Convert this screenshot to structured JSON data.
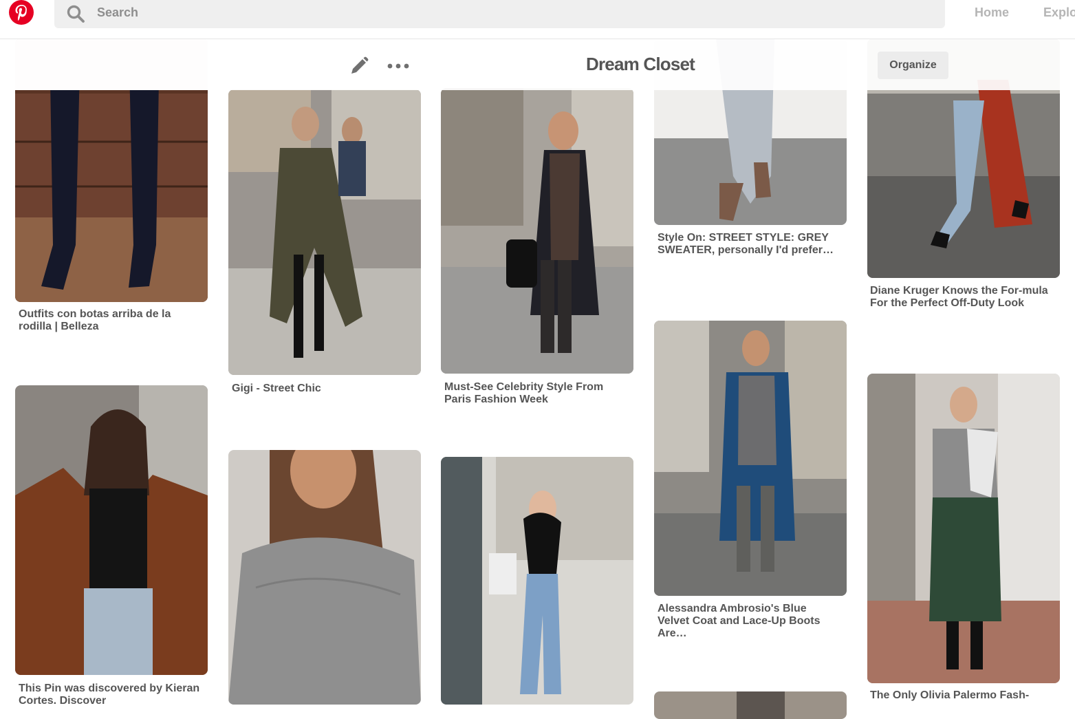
{
  "nav": {
    "search_placeholder": "Search",
    "home": "Home",
    "explore": "Explo"
  },
  "board": {
    "title": "Dream Closet",
    "organize": "Organize"
  },
  "pins": [
    {
      "caption": "Outfits con botas arriba de la rodilla | Belleza"
    },
    {
      "caption": "Gigi - Street Chic"
    },
    {
      "caption": "Must-See Celebrity Style From Paris Fashion Week"
    },
    {
      "caption": "Style On: STREET STYLE: GREY SWEATER, personally I'd prefer…"
    },
    {
      "caption": "Diane Kruger Knows the For-mula For the Perfect Off-Duty Look"
    },
    {
      "caption": "This Pin was discovered by Kieran Cortes. Discover"
    },
    {
      "caption": "Alessandra Ambrosio's Blue Velvet Coat and Lace-Up Boots Are…"
    },
    {
      "caption": "The Only Olivia Palermo Fash-"
    }
  ],
  "colors": {
    "brand": "#e60023",
    "caption_text": "#555555",
    "nav_text": "#b5b5b5"
  }
}
